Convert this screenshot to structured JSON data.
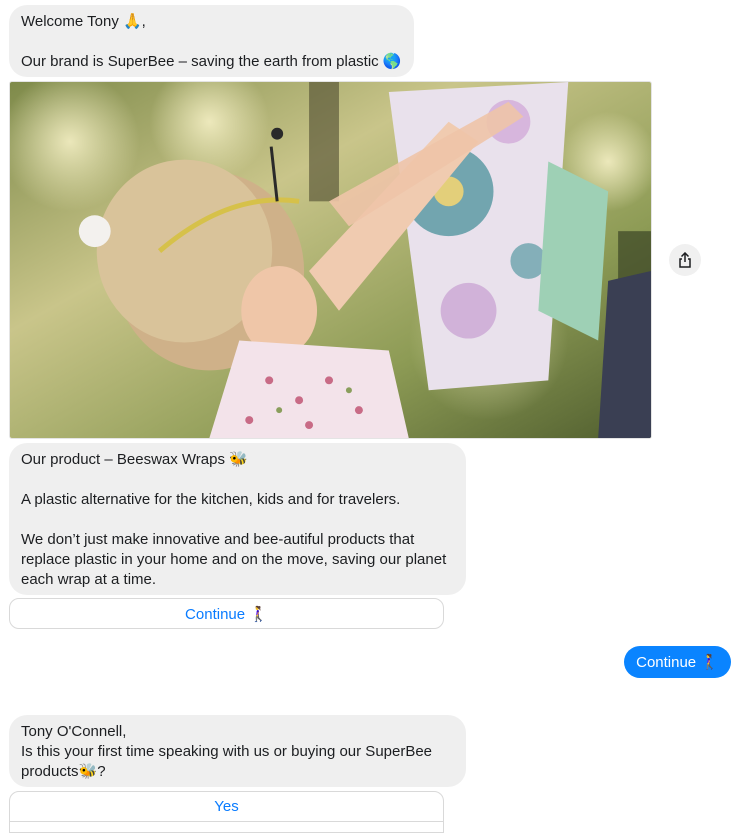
{
  "messages": {
    "welcome": {
      "line1": "Welcome Tony 🙏,",
      "line2": "Our brand is SuperBee – saving the earth from plastic 🌎"
    },
    "product": {
      "line1": "Our product – Beeswax Wraps 🐝",
      "line2": "A plastic alternative for the kitchen, kids and for travelers.",
      "line3": "We don’t just make innovative and bee-autiful products that replace plastic in your home and on the move, saving our planet each wrap at a time."
    },
    "continue_button": "Continue 🚶‍♀️",
    "user_reply": "Continue 🚶‍♀️",
    "question": {
      "line1": "Tony O'Connell,",
      "line2": "Is this your first time speaking with us or buying our SuperBee products🐝?"
    },
    "yes_button": "Yes"
  },
  "colors": {
    "bot_bubble": "#efefef",
    "user_bubble": "#0a84ff",
    "link": "#0a7cff"
  },
  "icons": {
    "share": "share-icon"
  }
}
